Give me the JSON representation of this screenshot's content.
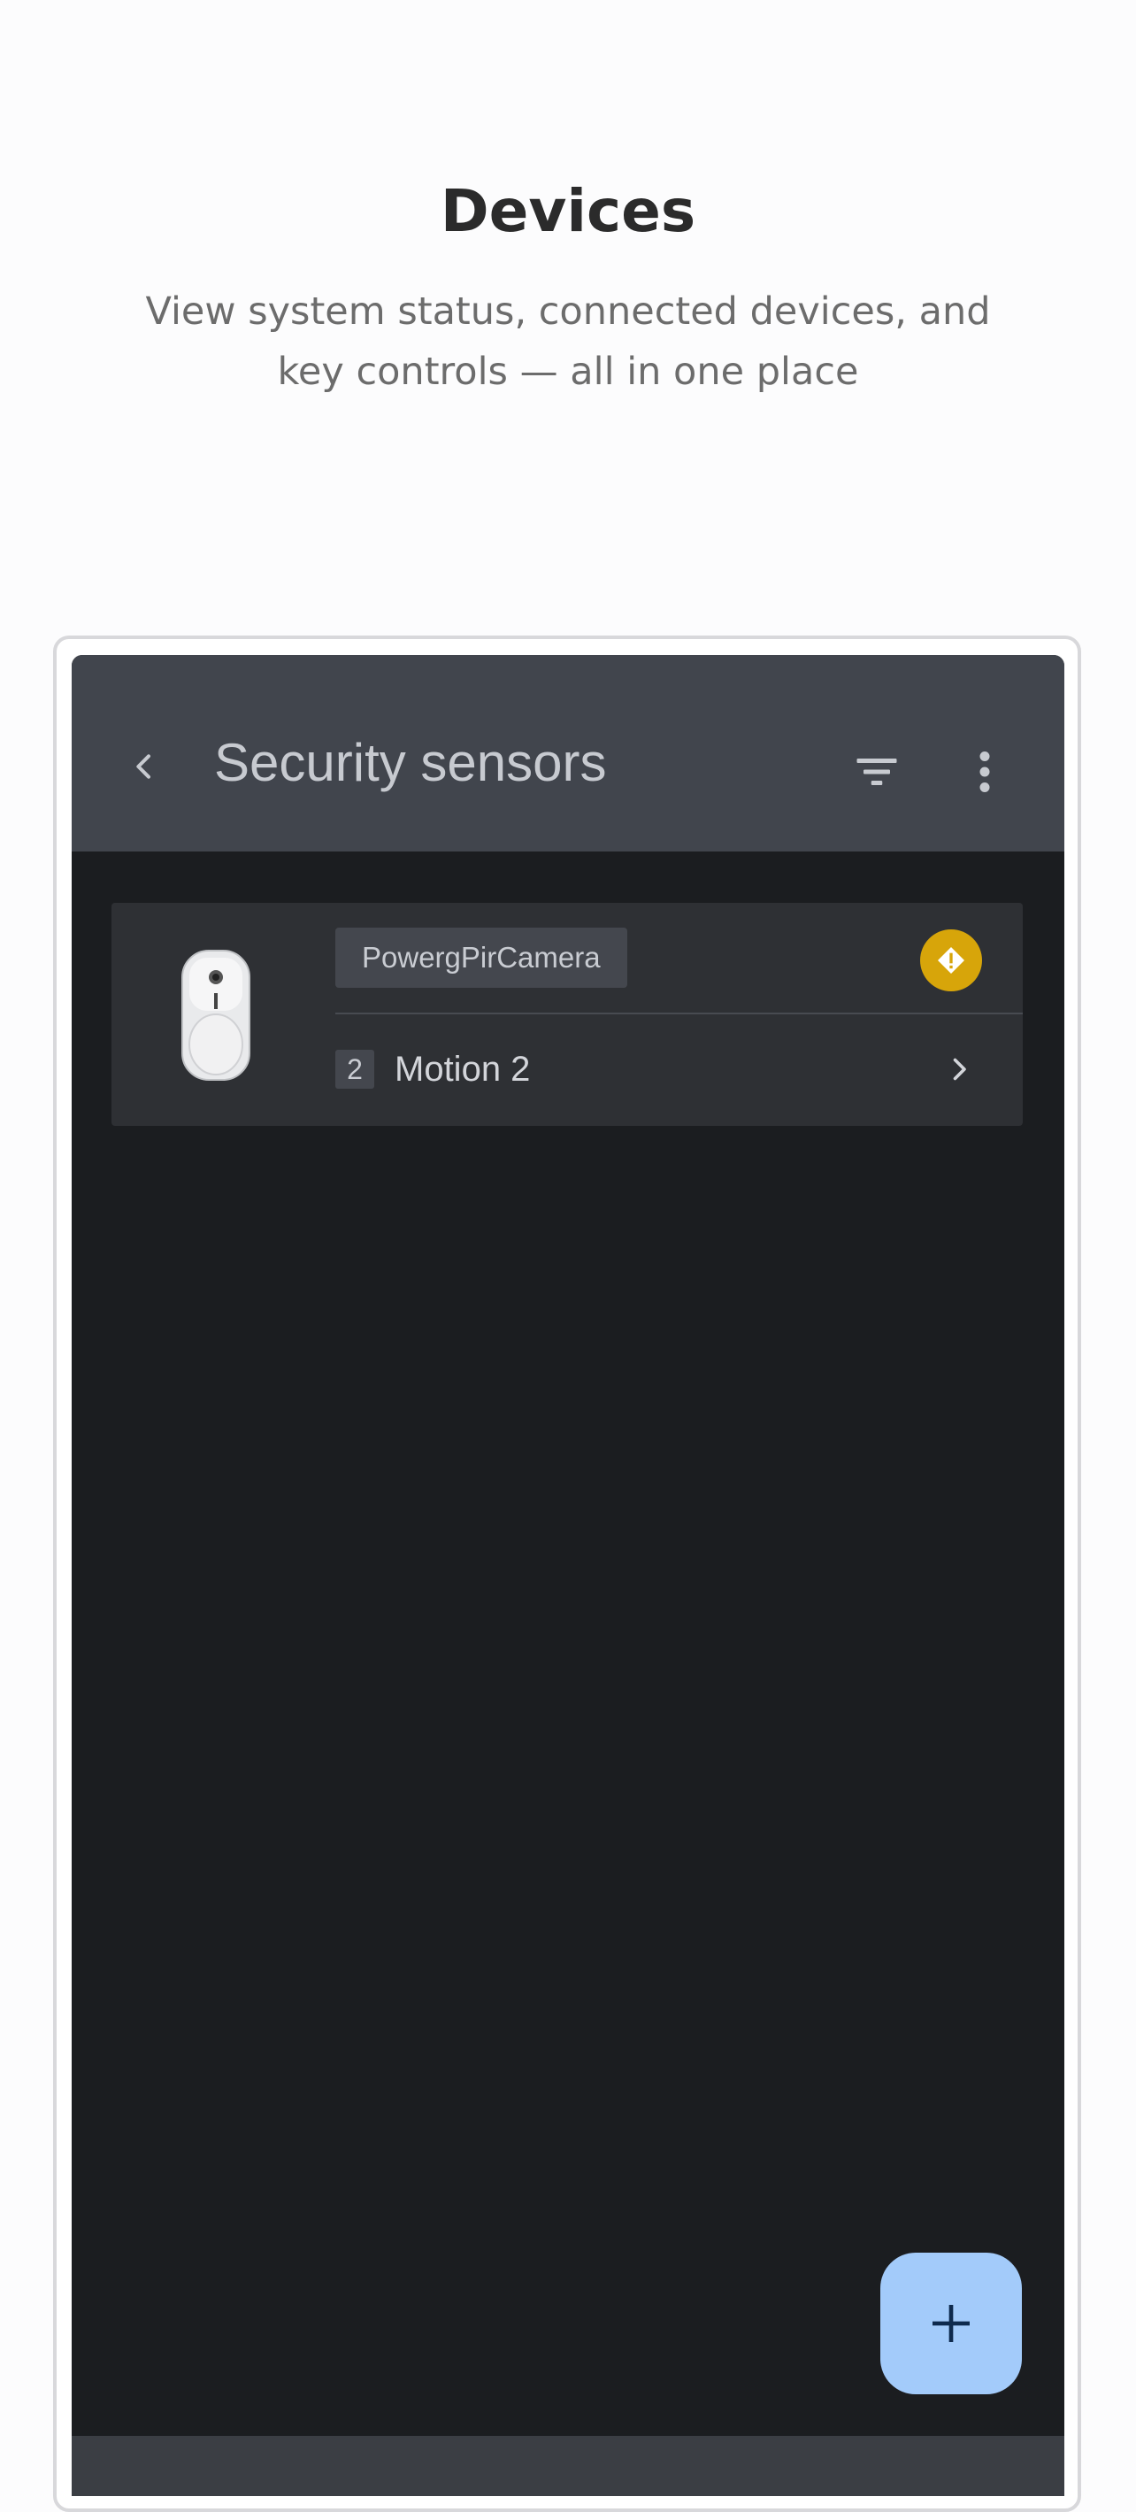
{
  "promo": {
    "title": "Devices",
    "subtitle": "View system status, connected devices, and key controls — all in one place"
  },
  "app_bar": {
    "title": "Security sensors",
    "back_icon": "chevron-left-icon",
    "filter_icon": "filter-icon",
    "more_icon": "more-vert-icon"
  },
  "devices": [
    {
      "model": "PowergPirCamera",
      "zone_number": "2",
      "name": "Motion 2",
      "status_icon": "warning-icon",
      "status_color": "#d7a50a"
    }
  ],
  "fab": {
    "icon": "plus-icon"
  },
  "colors": {
    "app_bar": "#41454d",
    "background": "#1b1d20",
    "card": "#2e3034",
    "fab": "#a3cbfa",
    "warning": "#d7a50a"
  }
}
